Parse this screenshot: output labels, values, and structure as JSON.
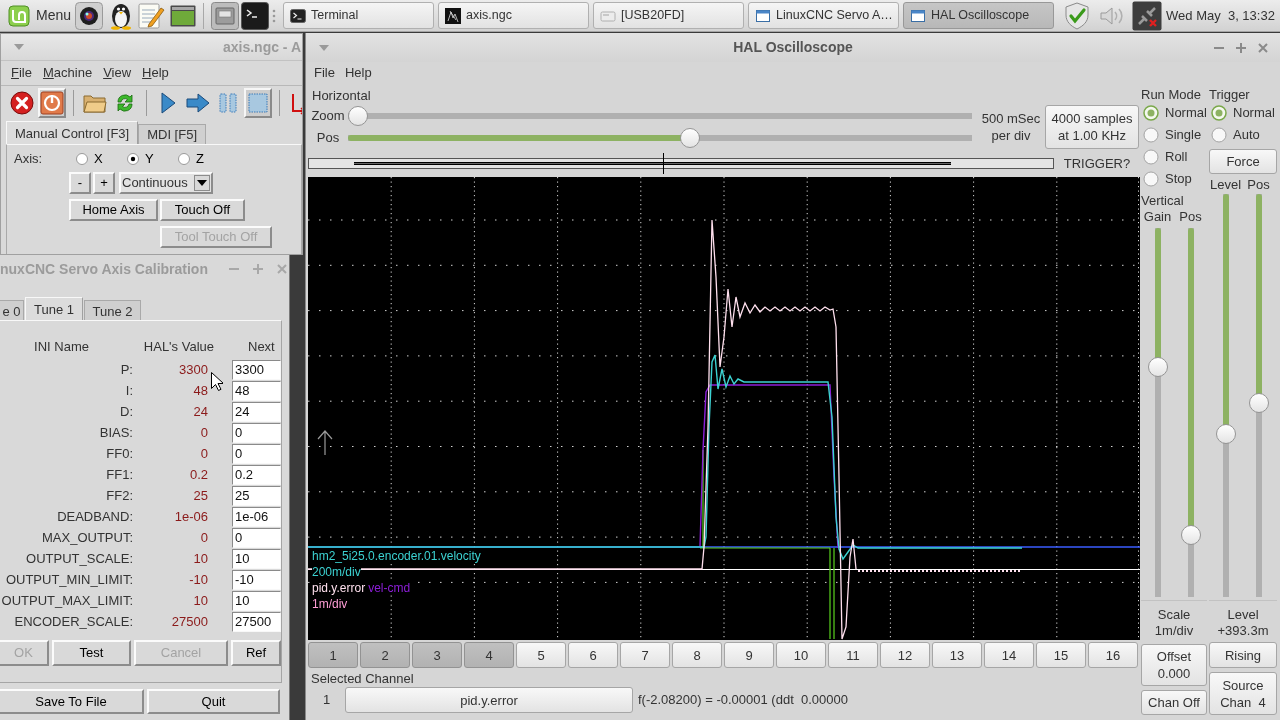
{
  "taskbar": {
    "menu_label": "Menu",
    "tasks": [
      {
        "label": "Terminal",
        "kind": "terminal",
        "selected": false
      },
      {
        "label": "axis.ngc",
        "kind": "preview",
        "selected": false
      },
      {
        "label": "[USB20FD]",
        "kind": "drive",
        "selected": false
      },
      {
        "label": "LinuxCNC Servo A…",
        "kind": "window",
        "selected": false
      },
      {
        "label": "HAL Oscilloscope",
        "kind": "window",
        "selected": true
      }
    ],
    "clock": "Wed May  3, 13:32"
  },
  "axis_window": {
    "title": "axis.ngc - A",
    "menu": [
      "File",
      "Machine",
      "View",
      "Help"
    ],
    "toolbar_groups": [
      {
        "items": [
          {
            "kind": "estop",
            "pressed": false
          },
          {
            "kind": "power",
            "pressed": true
          }
        ]
      },
      {
        "items": [
          {
            "kind": "open",
            "pressed": false
          },
          {
            "kind": "reload",
            "pressed": false
          }
        ]
      },
      {
        "items": [
          {
            "kind": "run",
            "pressed": false
          },
          {
            "kind": "step",
            "pressed": false
          },
          {
            "kind": "pause",
            "pressed": false
          },
          {
            "kind": "stop",
            "pressed": true
          }
        ]
      },
      {
        "items": [
          {
            "kind": "touchoff",
            "pressed": false
          }
        ]
      }
    ],
    "tabs": [
      {
        "label": "Manual Control [F3]",
        "selected": true
      },
      {
        "label": "MDI [F5]",
        "selected": false
      }
    ],
    "axis_label": "Axis:",
    "axes": [
      {
        "label": "X",
        "selected": false
      },
      {
        "label": "Y",
        "selected": true
      },
      {
        "label": "Z",
        "selected": false
      }
    ],
    "jog_buttons": [
      "-",
      "+"
    ],
    "jog_mode": "Continuous",
    "buttons": [
      {
        "label": "Home Axis",
        "disabled": false
      },
      {
        "label": "Touch Off",
        "disabled": false
      },
      {
        "label": "Tool Touch Off",
        "disabled": true
      }
    ]
  },
  "calibration_window": {
    "title": "nuxCNC Servo Axis Calibration",
    "tabs": [
      {
        "label": "e 0",
        "selected": false
      },
      {
        "label": "Tune 1",
        "selected": true
      },
      {
        "label": "Tune 2",
        "selected": false
      }
    ],
    "columns": [
      "INI Name",
      "HAL's Value",
      "Next"
    ],
    "rows": [
      {
        "name": "P:",
        "value": "3300",
        "next": "3300"
      },
      {
        "name": "I:",
        "value": "48",
        "next": "48"
      },
      {
        "name": "D:",
        "value": "24",
        "next": "24"
      },
      {
        "name": "BIAS:",
        "value": "0",
        "next": "0"
      },
      {
        "name": "FF0:",
        "value": "0",
        "next": "0"
      },
      {
        "name": "FF1:",
        "value": "0.2",
        "next": "0.2"
      },
      {
        "name": "FF2:",
        "value": "25",
        "next": "25"
      },
      {
        "name": "DEADBAND:",
        "value": "1e-06",
        "next": "1e-06"
      },
      {
        "name": "MAX_OUTPUT:",
        "value": "0",
        "next": "0"
      },
      {
        "name": "OUTPUT_SCALE:",
        "value": "10",
        "next": "10"
      },
      {
        "name": "OUTPUT_MIN_LIMIT:",
        "value": "-10",
        "next": "-10"
      },
      {
        "name": "OUTPUT_MAX_LIMIT:",
        "value": "10",
        "next": "10"
      },
      {
        "name": "ENCODER_SCALE:",
        "value": "27500",
        "next": "27500"
      }
    ],
    "buttons": [
      {
        "label": "OK",
        "disabled": true
      },
      {
        "label": "Test",
        "disabled": false
      },
      {
        "label": "Cancel",
        "disabled": true
      },
      {
        "label": "Ref",
        "disabled": false
      }
    ],
    "footer_buttons": [
      "Save To File",
      "Quit"
    ]
  },
  "scope_window": {
    "title": "HAL Oscilloscope",
    "menu": [
      "File",
      "Help"
    ],
    "horizontal": {
      "heading": "Horizontal",
      "zoom_label": "Zoom",
      "zoom_slider": {
        "level": 0
      },
      "pos_label": "Pos",
      "pos_slider": {
        "level": 0.55
      },
      "timebase": [
        "500 mSec",
        "per div"
      ],
      "samples_button": [
        "4000 samples",
        "at 1.00 KHz"
      ]
    },
    "record_bar": {
      "level": 0.476
    },
    "trigger_status": "TRIGGER?",
    "trace_labels": [
      {
        "parts": [
          {
            "text": "hm2_5i25.0.encoder.01.velocity",
            "color": "#3cd2d2"
          }
        ]
      },
      {
        "parts": [
          {
            "text": "200m/div",
            "color": "#3cd2d2"
          }
        ]
      },
      {
        "parts": [
          {
            "text": "pid.y.error",
            "color": "#ffe0ee"
          },
          {
            "text": "vel-cmd",
            "color": "#8c1ed8"
          }
        ]
      },
      {
        "parts": [
          {
            "text": "1m/div",
            "color": "#ff9ed6"
          }
        ]
      }
    ],
    "channels": [
      {
        "label": "1",
        "on": true
      },
      {
        "label": "2",
        "on": true
      },
      {
        "label": "3",
        "on": true
      },
      {
        "label": "4",
        "on": true
      },
      {
        "label": "5",
        "on": false
      },
      {
        "label": "6",
        "on": false
      },
      {
        "label": "7",
        "on": false
      },
      {
        "label": "8",
        "on": false
      },
      {
        "label": "9",
        "on": false
      },
      {
        "label": "10",
        "on": false
      },
      {
        "label": "11",
        "on": false
      },
      {
        "label": "12",
        "on": false
      },
      {
        "label": "13",
        "on": false
      },
      {
        "label": "14",
        "on": false
      },
      {
        "label": "15",
        "on": false
      },
      {
        "label": "16",
        "on": false
      }
    ],
    "selected_channel": {
      "heading": "Selected Channel",
      "number": "1",
      "name": "pid.y.error",
      "readout": "f(-2.08200) = -0.00001 (ddt  0.00000"
    },
    "run_mode": {
      "heading": "Run Mode",
      "options": [
        {
          "label": "Normal",
          "selected": true
        },
        {
          "label": "Single",
          "selected": false
        },
        {
          "label": "Roll",
          "selected": false
        },
        {
          "label": "Stop",
          "selected": false
        }
      ]
    },
    "vertical": {
      "heading": "Vertical",
      "gain_label": "Gain",
      "pos_label": "Pos",
      "gain_slider": {
        "level": 0.37
      },
      "pos_slider": {
        "level": 0.85
      },
      "scale_label": "Scale",
      "scale_value": "1m/div",
      "offset_button": [
        "Offset",
        "0.000"
      ],
      "chan_off_button": "Chan Off"
    },
    "trigger": {
      "heading": "Trigger",
      "options": [
        {
          "label": "Normal",
          "selected": true
        },
        {
          "label": "Auto",
          "selected": false
        }
      ],
      "force_button": "Force",
      "level_label": "Level",
      "pos_label": "Pos",
      "level_slider": {
        "level": 0.6
      },
      "pos_slider": {
        "level": 0.52
      },
      "readout_label": "Level",
      "readout_value": "+393.3m",
      "edge_button": "Rising",
      "source_button": [
        "Source",
        "Chan  4"
      ]
    }
  }
}
